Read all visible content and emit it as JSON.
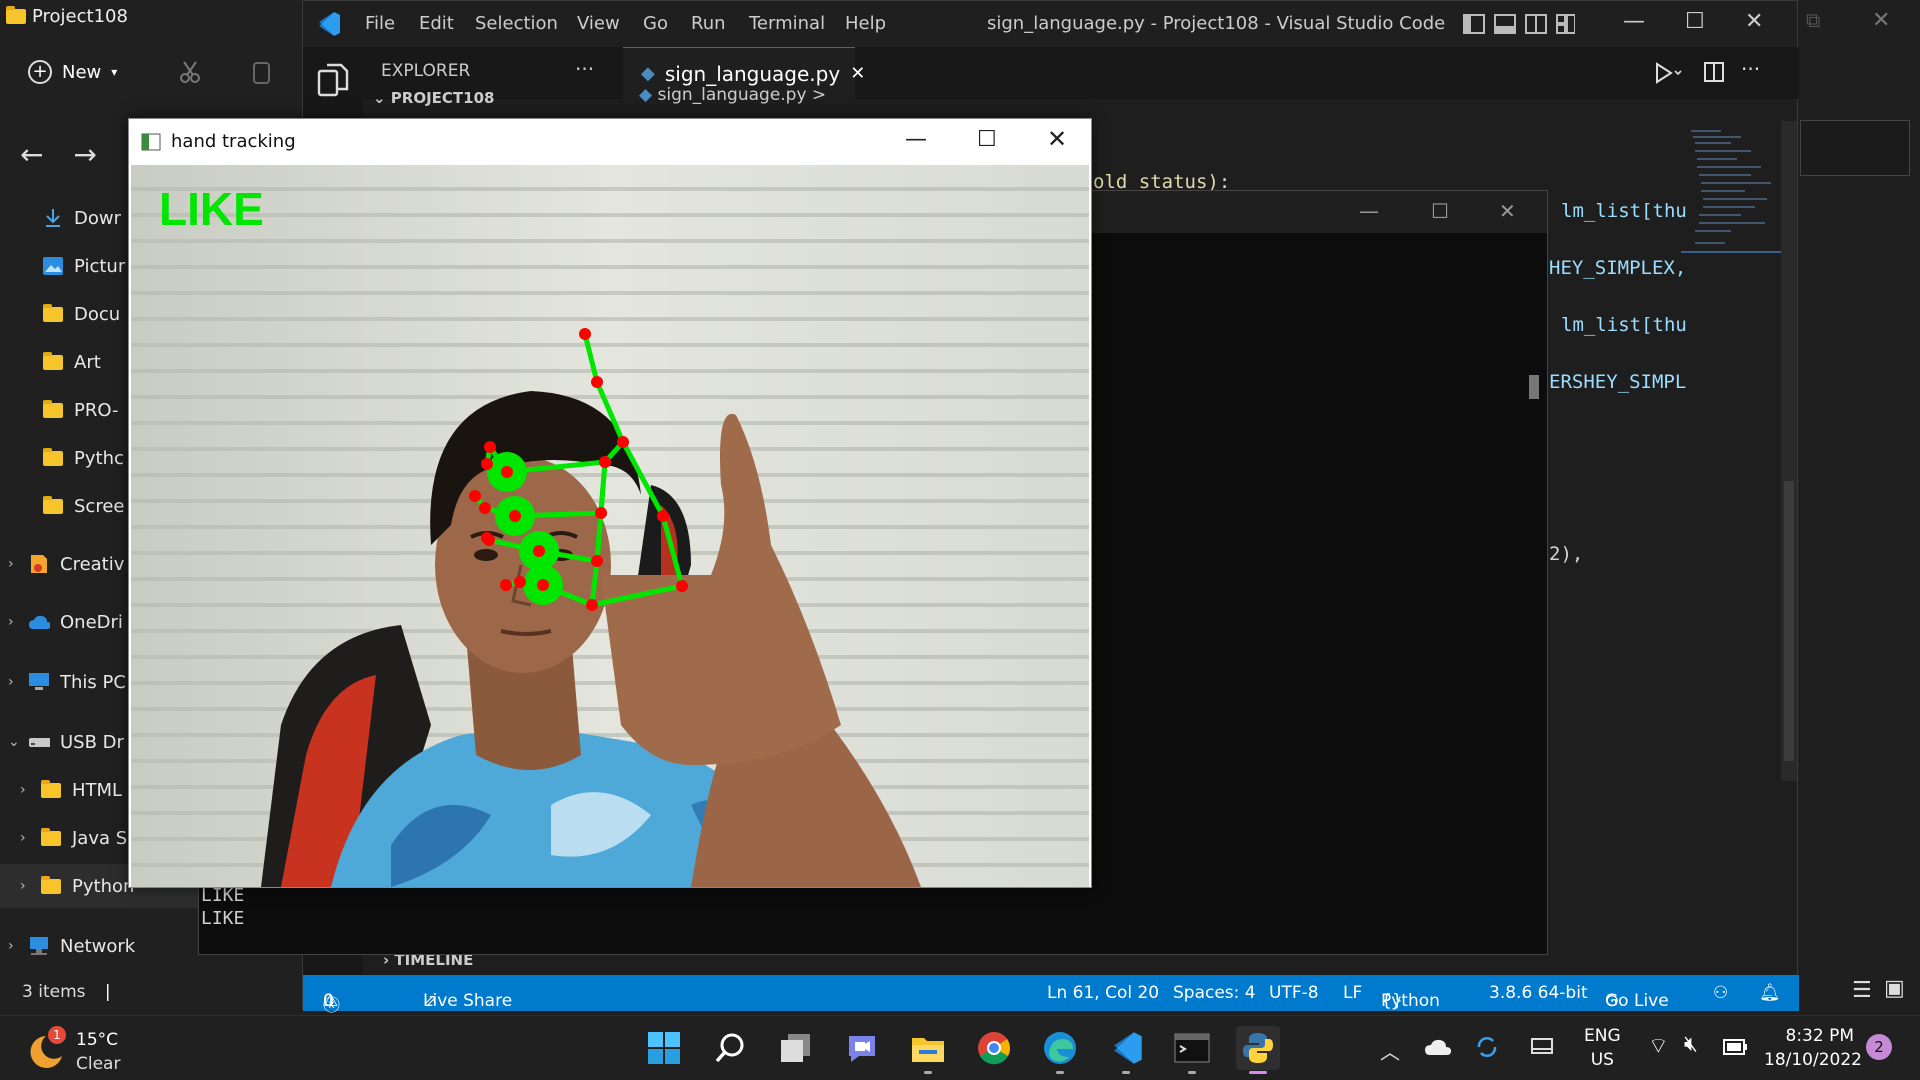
{
  "explorer": {
    "window_title": "Project108",
    "new_label": "New",
    "nav": {
      "back": "←",
      "forward": "→"
    },
    "items": [
      {
        "label": "Dowr",
        "icon": "download-icon"
      },
      {
        "label": "Pictur",
        "icon": "pictures-icon"
      },
      {
        "label": "Docu",
        "icon": "folder-icon"
      },
      {
        "label": "Art",
        "icon": "folder-icon"
      },
      {
        "label": "PRO-",
        "icon": "folder-icon"
      },
      {
        "label": "Pythc",
        "icon": "folder-icon"
      },
      {
        "label": "Scree",
        "icon": "folder-icon"
      },
      {
        "label": "Creativ",
        "icon": "creative-cloud-icon"
      },
      {
        "label": "OneDri",
        "icon": "onedrive-icon"
      },
      {
        "label": "This PC",
        "icon": "pc-icon"
      },
      {
        "label": "USB Dr",
        "icon": "usb-drive-icon"
      },
      {
        "label": "HTML",
        "icon": "folder-icon"
      },
      {
        "label": "Java S",
        "icon": "folder-icon"
      },
      {
        "label": "Python",
        "icon": "folder-icon"
      },
      {
        "label": "Network",
        "icon": "network-icon"
      }
    ],
    "status": "3 items"
  },
  "vscode": {
    "menu": [
      "File",
      "Edit",
      "Selection",
      "View",
      "Go",
      "Run",
      "Terminal",
      "Help"
    ],
    "title": "sign_language.py - Project108 - Visual Studio Code",
    "explorer_label": "EXPLORER",
    "more_label": "···",
    "project_label": "PROJECT108",
    "tab_label": "sign_language.py",
    "breadcrumb": "sign_language.py >",
    "timeline_label": "TIMELINE",
    "code_fragments": [
      "old_status):",
      "lm_list[thu",
      "HEY_SIMPLEX,",
      "lm_list[thu",
      "ERSHEY_SIMPL",
      "2),"
    ],
    "statusbar": {
      "errors": "0",
      "warnings": "0",
      "live_share": "Live Share",
      "position": "Ln 61, Col 20",
      "spaces": "Spaces: 4",
      "encoding": "UTF-8",
      "eol": "LF",
      "language": "Python",
      "interpreter": "3.8.6 64-bit",
      "go_live": "Go Live"
    },
    "accent": "#007acc"
  },
  "console": {
    "output": [
      "LIKE",
      "LIKE"
    ]
  },
  "hand_window": {
    "title": "hand tracking",
    "gesture_label": "LIKE",
    "landmark_color": "#ff0000",
    "connection_color": "#00e600"
  },
  "taskbar": {
    "weather": {
      "temp": "15°C",
      "condition": "Clear",
      "badge": "1"
    },
    "lang": "ENG",
    "region": "US",
    "time": "8:32 PM",
    "date": "18/10/2022",
    "notifications": "2"
  }
}
